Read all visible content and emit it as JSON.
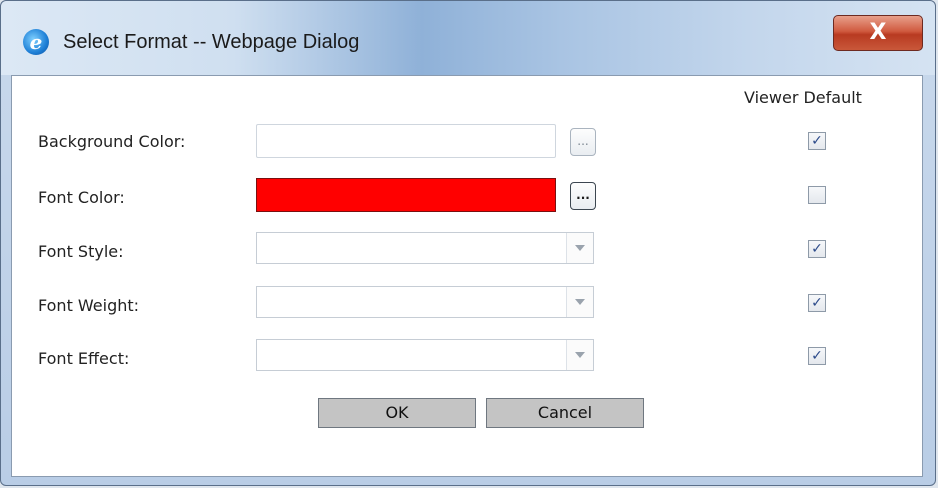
{
  "window": {
    "title": "Select Format -- Webpage Dialog",
    "icon": "ie-icon",
    "close_label": "X"
  },
  "header": {
    "viewer_default_label": "Viewer Default"
  },
  "rows": [
    {
      "label": "Background Color:",
      "control": "text",
      "value": "",
      "viewer_default": true
    },
    {
      "label": "Font Color:",
      "control": "color",
      "value": "#ff0000",
      "viewer_default": false
    },
    {
      "label": "Font Style:",
      "control": "select",
      "value": "",
      "viewer_default": true
    },
    {
      "label": "Font Weight:",
      "control": "select",
      "value": "",
      "viewer_default": true
    },
    {
      "label": "Font Effect:",
      "control": "select",
      "value": "",
      "viewer_default": true
    }
  ],
  "ellipsis_label": "...",
  "checkmark": "✓",
  "buttons": {
    "ok_label": "OK",
    "cancel_label": "Cancel"
  },
  "colors": {
    "font_color_swatch": "#ff0000",
    "close_button": "#c8462b"
  }
}
